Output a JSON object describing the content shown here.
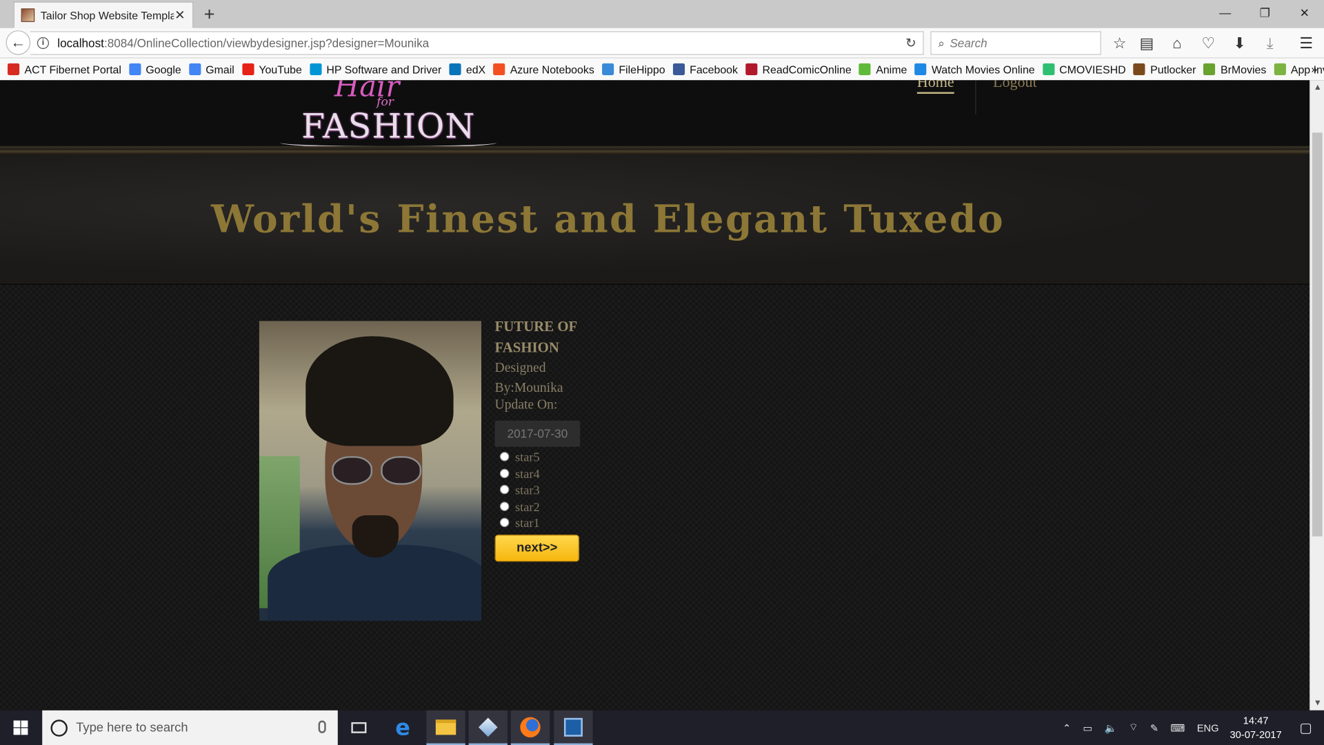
{
  "browser": {
    "tab_title": "Tailor Shop Website Templa",
    "url_host": "localhost",
    "url_path": ":8084/OnlineCollection/viewbydesigner.jsp?designer=Mounika",
    "search_placeholder": "Search",
    "bookmarks": [
      {
        "label": "ACT Fibernet Portal",
        "color": "#d62b20"
      },
      {
        "label": "Google",
        "color": "#4285f4"
      },
      {
        "label": "Gmail",
        "color": "#4285f4"
      },
      {
        "label": "YouTube",
        "color": "#e62117"
      },
      {
        "label": "HP Software and Driver",
        "color": "#0096d6"
      },
      {
        "label": "edX",
        "color": "#0a74b8"
      },
      {
        "label": "Azure Notebooks",
        "color": "#f25022"
      },
      {
        "label": "FileHippo",
        "color": "#3a8ad8"
      },
      {
        "label": "Facebook",
        "color": "#3b5998"
      },
      {
        "label": "ReadComicOnline",
        "color": "#b2182b"
      },
      {
        "label": "Anime",
        "color": "#5fba3a"
      },
      {
        "label": "Watch Movies Online",
        "color": "#1e88e5"
      },
      {
        "label": "CMOVIESHD",
        "color": "#2fbf71"
      },
      {
        "label": "Putlocker",
        "color": "#7a4a1e"
      },
      {
        "label": "BrMovies",
        "color": "#6aa22f"
      },
      {
        "label": "App Inventor",
        "color": "#7cb342"
      }
    ]
  },
  "site": {
    "logo_script": "Hair",
    "logo_for": "for",
    "logo_main": "FASHION",
    "nav": {
      "home": "Home",
      "logout": "Logout"
    },
    "hero_title": "World's Finest and Elegant Tuxedo"
  },
  "product": {
    "title": "FUTURE OF FASHION",
    "designed_label": "Designed",
    "designed_by": "By:Mounika",
    "update_label": "Update On:",
    "date": "2017-07-30",
    "ratings": [
      "star5",
      "star4",
      "star3",
      "star2",
      "star1"
    ],
    "next_label": "next>>"
  },
  "taskbar": {
    "search_placeholder": "Type here to search",
    "lang": "ENG",
    "time": "14:47",
    "date": "30-07-2017"
  },
  "colors": {
    "hero_text": "#8d7736",
    "button_yellow": "#f6b60e",
    "page_bg": "#141414"
  }
}
